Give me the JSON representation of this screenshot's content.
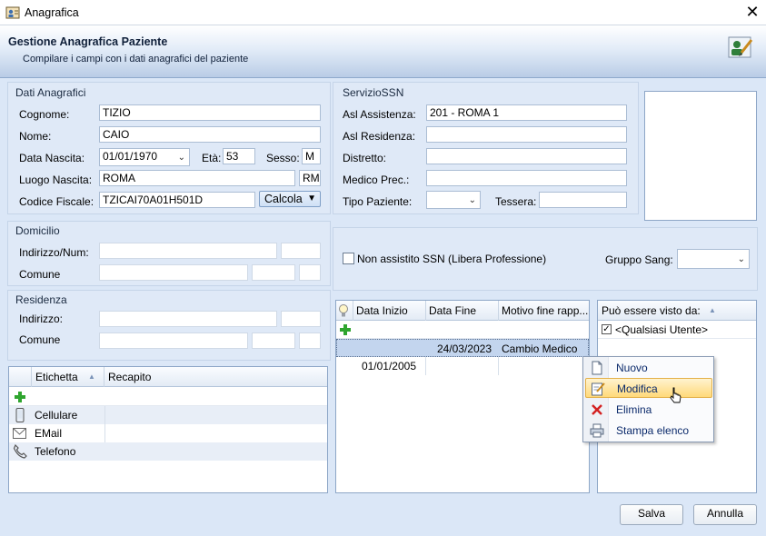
{
  "window": {
    "title": "Anagrafica",
    "close_glyph": "✕"
  },
  "header": {
    "title": "Gestione Anagrafica Paziente",
    "subtitle": "Compilare i campi con i dati anagrafici del paziente"
  },
  "dati": {
    "group": "Dati Anagrafici",
    "cognome_label": "Cognome:",
    "cognome": "TIZIO",
    "nome_label": "Nome:",
    "nome": "CAIO",
    "nascita_label": "Data Nascita:",
    "nascita": "01/01/1970",
    "eta_label": "Età:",
    "eta": "53",
    "sesso_label": "Sesso:",
    "sesso": "M",
    "luogo_label": "Luogo Nascita:",
    "luogo": "ROMA",
    "provincia": "RM",
    "cf_label": "Codice Fiscale:",
    "cf": "TZICAI70A01H501D",
    "calcola": "Calcola"
  },
  "ssn": {
    "group": "ServizioSSN",
    "asl_assistenza_label": "Asl Assistenza:",
    "asl_assistenza": "201 - ROMA 1",
    "asl_residenza_label": "Asl Residenza:",
    "distretto_label": "Distretto:",
    "medico_label": "Medico Prec.:",
    "tipo_label": "Tipo Paziente:",
    "tessera_label": "Tessera:"
  },
  "domicilio": {
    "group": "Domicilio",
    "indirizzo_label": "Indirizzo/Num:",
    "comune_label": "Comune"
  },
  "residenza": {
    "group": "Residenza",
    "indirizzo_label": "Indirizzo:",
    "comune_label": "Comune"
  },
  "misc": {
    "non_assistito": "Non assistito SSN (Libera Professione)",
    "gruppo_label": "Gruppo Sang:"
  },
  "recapiti": {
    "columns": [
      "Etichetta",
      "Recapito"
    ],
    "rows": [
      {
        "icon": "mobile-phone-icon",
        "label": "Cellulare"
      },
      {
        "icon": "envelope-icon",
        "label": "EMail"
      },
      {
        "icon": "telephone-icon",
        "label": "Telefono"
      }
    ]
  },
  "periodi": {
    "columns": [
      "Data Inizio",
      "Data Fine",
      "Motivo fine rapp..."
    ],
    "rows": [
      {
        "inizio": "",
        "fine": "24/03/2023",
        "motivo": "Cambio Medico"
      },
      {
        "inizio": "01/01/2005",
        "fine": "",
        "motivo": ""
      }
    ]
  },
  "visibilita": {
    "column": "Può essere visto da:",
    "rows": [
      {
        "label": "<Qualsiasi Utente>",
        "checked": true
      }
    ]
  },
  "context_menu": {
    "items": [
      {
        "label": "Nuovo",
        "icon": "new-document-icon"
      },
      {
        "label": "Modifica",
        "icon": "edit-document-icon"
      },
      {
        "label": "Elimina",
        "icon": "delete-x-icon"
      },
      {
        "label": "Stampa elenco",
        "icon": "printer-icon"
      }
    ]
  },
  "footer": {
    "salva": "Salva",
    "annulla": "Annulla"
  },
  "colors": {
    "accent": "#8fa9cc",
    "panel": "#dfe9f7",
    "highlight": "#ffd97a",
    "delete": "#d32020",
    "add": "#2fa52f"
  }
}
